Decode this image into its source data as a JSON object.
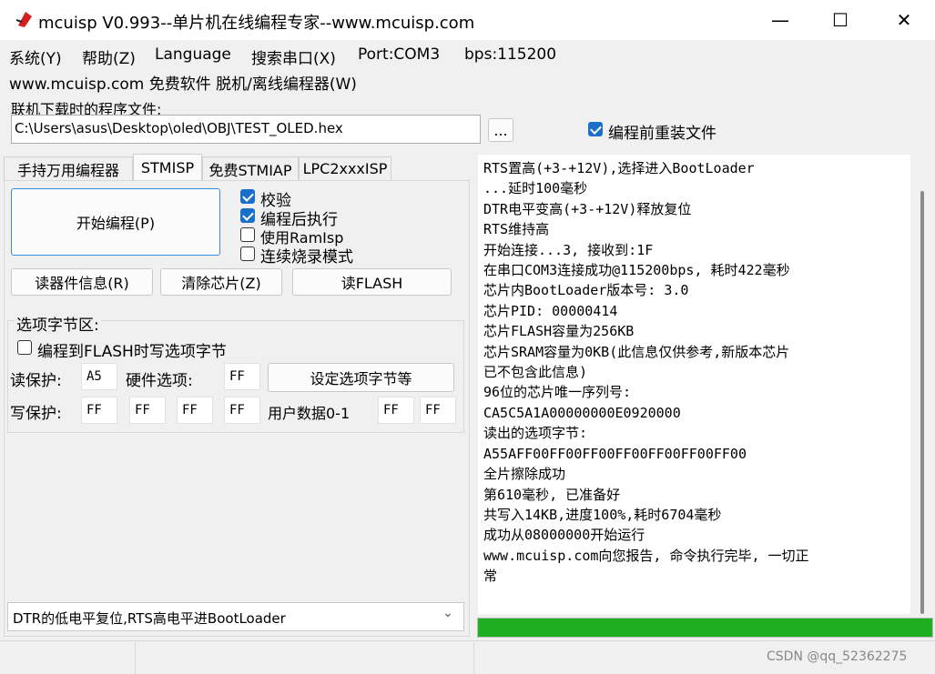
{
  "window": {
    "title": "mcuisp V0.993--单片机在线编程专家--www.mcuisp.com",
    "minimize": "—",
    "maximize": "☐",
    "close": "✕"
  },
  "menu": [
    "系统(Y)",
    "帮助(Z)",
    "Language",
    "搜索串口(X)",
    "Port:COM3",
    "bps:115200"
  ],
  "menu_row2": "www.mcuisp.com 免费软件 脱机/离线编程器(W)",
  "file": {
    "label": "联机下载时的程序文件:",
    "path": "C:\\Users\\asus\\Desktop\\oled\\OBJ\\TEST_OLED.hex",
    "browse": "...",
    "reload_label": "编程前重装文件",
    "reload_checked": true
  },
  "tabs": [
    "手持万用编程器",
    "STMISP",
    "免费STMIAP",
    "LPC2xxxISP"
  ],
  "actions": {
    "start": "开始编程(P)",
    "verify": "校验",
    "run_after": "编程后执行",
    "use_ramisp": "使用RamIsp",
    "continuous": "连续烧录模式",
    "read_info": "读器件信息(R)",
    "erase": "清除芯片(Z)",
    "read_flash": "读FLASH"
  },
  "options": {
    "group_title": "选项字节区:",
    "write_opt_label": "编程到FLASH时写选项字节",
    "read_protect_label": "读保护:",
    "read_protect_value": "A5",
    "hw_opt_label": "硬件选项:",
    "hw_opt_value": "FF",
    "set_button": "设定选项字节等",
    "write_protect_label": "写保护:",
    "write_protect_values": [
      "FF",
      "FF",
      "FF",
      "FF"
    ],
    "user_data_label": "用户数据0-1",
    "user_data_values": [
      "FF",
      "FF"
    ]
  },
  "dtr_select": "DTR的低电平复位,RTS高电平进BootLoader",
  "log_lines": [
    "RTS置高(+3-+12V),选择进入BootLoader",
    "...延时100毫秒",
    "DTR电平变高(+3-+12V)释放复位",
    "RTS维持高",
    "开始连接...3, 接收到:1F",
    "在串口COM3连接成功@115200bps, 耗时422毫秒",
    "芯片内BootLoader版本号: 3.0",
    "芯片PID: 00000414",
    "芯片FLASH容量为256KB",
    "芯片SRAM容量为0KB(此信息仅供参考,新版本芯片",
    "已不包含此信息)",
    "96位的芯片唯一序列号:",
    "CA5C5A1A00000000E0920000",
    "读出的选项字节:",
    "A55AFF00FF00FF00FF00FF00FF00FF00",
    "全片擦除成功",
    "第610毫秒, 已准备好",
    "共写入14KB,进度100%,耗时6704毫秒",
    "成功从08000000开始运行",
    "www.mcuisp.com向您报告, 命令执行完毕, 一切正",
    "常"
  ],
  "progress": 1.0,
  "colors": {
    "progress": "#1fae1f",
    "accent": "#1a6fc9",
    "icon": "#d21f1f"
  },
  "watermark": "CSDN @qq_52362275"
}
